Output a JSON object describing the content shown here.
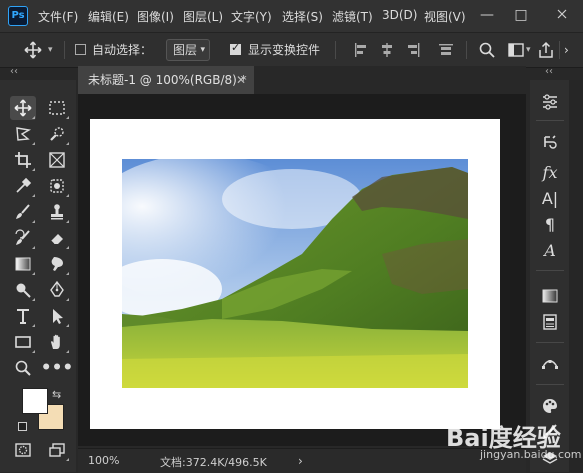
{
  "app": {
    "logo": "Ps"
  },
  "menus": [
    "文件(F)",
    "编辑(E)",
    "图像(I)",
    "图层(L)",
    "文字(Y)",
    "选择(S)",
    "滤镜(T)",
    "3D(D)",
    "视图(V)"
  ],
  "window_controls": {
    "minimize": "—",
    "maximize": "□"
  },
  "options": {
    "auto_select_label": "自动选择：",
    "auto_select_checked": false,
    "auto_select_value": "图层",
    "show_transform_label": "显示变换控件",
    "show_transform_checked": true
  },
  "panel_collapse": "‹‹",
  "document": {
    "tab_title": "未标题-1 @ 100%(RGB/8) *",
    "close": "✕"
  },
  "tools": [
    "move-tool",
    "marquee-tool",
    "lasso-tool",
    "quick-select-tool",
    "crop-tool",
    "frame-tool",
    "eyedropper-tool",
    "patch-tool",
    "brush-tool",
    "stamp-tool",
    "history-brush-tool",
    "eraser-tool",
    "gradient-tool",
    "smudge-tool",
    "dodge-tool",
    "pen-tool",
    "type-tool",
    "path-select-tool",
    "rectangle-tool",
    "hand-tool",
    "zoom-tool",
    "more-tools"
  ],
  "colors": {
    "foreground": "#ffffff",
    "background": "#f4ddb5",
    "ui_bg": "#282828"
  },
  "status": {
    "zoom": "100%",
    "doc_info": "文档:372.4K/496.5K",
    "arrow": "›"
  },
  "right_panel_icons": [
    "adjustments-icon",
    "history-icon",
    "fx-icon",
    "character-icon",
    "paragraph-icon",
    "glyphs-icon",
    "gradients-icon",
    "properties-icon",
    "paths-icon",
    "swatches-icon",
    "brush-icon",
    "layers-icon"
  ],
  "watermark": {
    "text": "Bai度经验",
    "sub": "jingyan.baidu.com"
  }
}
